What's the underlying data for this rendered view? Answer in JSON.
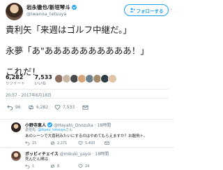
{
  "author": {
    "name": "岩永徹也/新垣琴斗",
    "handle": "@iwanoa_tetsuya"
  },
  "follow_button": {
    "label": "フォローする"
  },
  "tweet": {
    "line1": "貴利矢「来週はゴルフ中継だ。」",
    "line2": "永夢「あ\"ああああああああああ！」",
    "line3": "これだ！"
  },
  "stats": {
    "retweets_count": "6,282",
    "retweets_label": "リツイート",
    "likes_count": "7,533",
    "likes_label": "いいね"
  },
  "timestamp": "20:57 - 2017年6月18日",
  "main_actions": {
    "reply": "96",
    "retweet": "6,282",
    "like": "7,533"
  },
  "replies": [
    {
      "name": "小野寺恵人",
      "handle": "@Hayato_Onozuka · 18時間",
      "reply_prefix": "返信先:",
      "reply_to": "@Ikyou_tetsuya",
      "reply_suffix": "さん",
      "text": "あのシーンで大喜利みたいにするのはやめてもらえますか？お題飛ト。",
      "counts": {
        "reply": "15",
        "retweet": "2,271",
        "like": "5,493"
      }
    },
    {
      "name": "ボッビィチェイス",
      "handle": "@mikuki_yayoi · 18時間",
      "text": "死んだん間は",
      "counts": {
        "reply": "1",
        "retweet": "8",
        "like": "24"
      }
    }
  ],
  "colors": {
    "accent": "#1da1f2",
    "muted": "#657786",
    "like": "#e0245e"
  }
}
